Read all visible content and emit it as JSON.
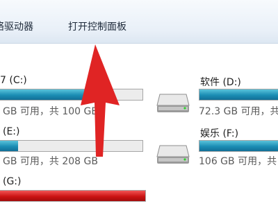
{
  "toolbar": {
    "network_drive": "络驱动器",
    "control_panel": "打开控制面板"
  },
  "drives": {
    "c": {
      "name": "7 (C:)",
      "info": "GB 可用，共 100 GB",
      "used_fraction": 0.7
    },
    "d": {
      "name": "软件 (D:)",
      "info": "72.3 GB 可用，共",
      "used_fraction": 1.0
    },
    "e": {
      "name": "(E:)",
      "info": "GB 可用，共 208 GB",
      "used_fraction": 0.14
    },
    "f": {
      "name": "娱乐 (F:)",
      "info": "106 GB 可用，共",
      "used_fraction": 1.0
    },
    "g": {
      "name": "(G:)",
      "info": "",
      "used_fraction": 1.0
    }
  },
  "colors": {
    "bar_normal": "#1b8db4",
    "bar_full": "#cc1414",
    "arrow": "#e02424"
  }
}
